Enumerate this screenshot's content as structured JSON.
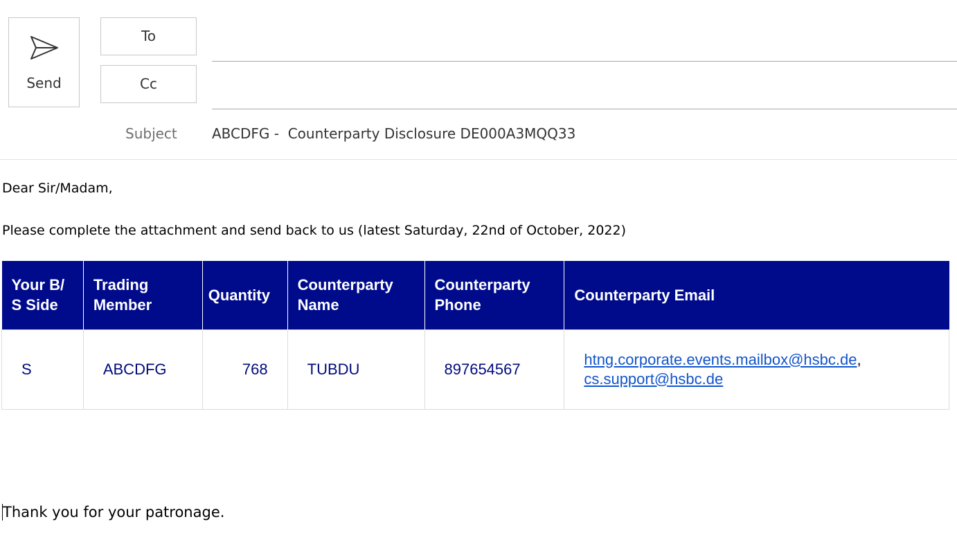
{
  "toolbar": {
    "send_label": "Send",
    "to_label": "To",
    "cc_label": "Cc"
  },
  "fields": {
    "to_value": "",
    "cc_value": "",
    "subject_label": "Subject",
    "subject_value": "ABCDFG -  Counterparty Disclosure DE000A3MQQ33"
  },
  "body": {
    "greeting": "Dear Sir/Madam,",
    "instruction": "Please complete the attachment and send back to us (latest Saturday, 22nd of October, 2022)",
    "closing": "Thank you for your patronage."
  },
  "table": {
    "headers": [
      "Your B/\nS Side",
      "Trading\nMember",
      "Quantity",
      "Counterparty\nName",
      "Counterparty\nPhone",
      "Counterparty Email"
    ],
    "row": {
      "side": "S",
      "trading_member": "ABCDFG",
      "quantity": "768",
      "cp_name": "TUBDU",
      "cp_phone": "897654567",
      "email_1": "htng.corporate.events.mailbox@hsbc.de",
      "email_separator": ",",
      "email_2": "cs.support@hsbc.de"
    }
  },
  "colors": {
    "header_bg": "#000b8c",
    "cell_text": "#000a7a",
    "link": "#1155cc"
  },
  "icons": {
    "send": "send-paper-plane-icon"
  }
}
